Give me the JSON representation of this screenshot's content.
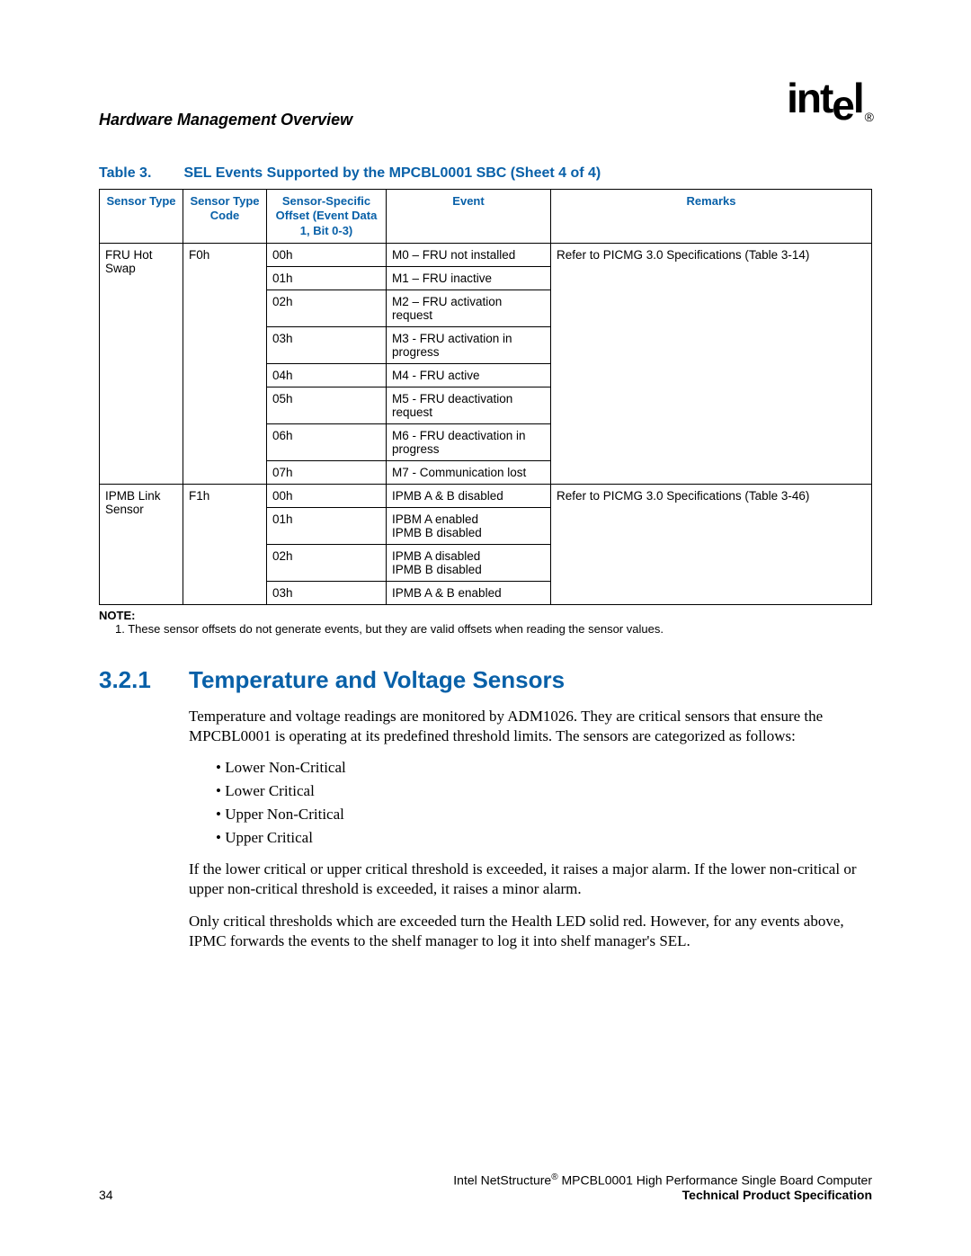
{
  "header": {
    "chapter_title": "Hardware Management Overview",
    "logo_text": "intel",
    "logo_reg": "®"
  },
  "table_caption": {
    "label": "Table 3.",
    "title": "SEL Events Supported by the MPCBL0001 SBC (Sheet 4 of 4)"
  },
  "table": {
    "headers": {
      "c0": "Sensor Type",
      "c1": "Sensor Type Code",
      "c2": "Sensor-Specific Offset (Event Data 1, Bit 0-3)",
      "c3": "Event",
      "c4": "Remarks"
    },
    "groups": [
      {
        "sensor_type": "FRU Hot Swap",
        "type_code": "F0h",
        "remarks": "Refer to PICMG 3.0 Specifications (Table 3-14)",
        "rows": [
          {
            "offset": "00h",
            "event": "M0 – FRU not installed"
          },
          {
            "offset": "01h",
            "event": "M1 – FRU inactive"
          },
          {
            "offset": "02h",
            "event": "M2 – FRU activation request"
          },
          {
            "offset": "03h",
            "event": "M3 - FRU activation in progress"
          },
          {
            "offset": "04h",
            "event": "M4 - FRU active"
          },
          {
            "offset": "05h",
            "event": "M5 - FRU deactivation request"
          },
          {
            "offset": "06h",
            "event": "M6 - FRU deactivation in progress"
          },
          {
            "offset": "07h",
            "event": "M7 - Communication lost"
          }
        ]
      },
      {
        "sensor_type": "IPMB Link Sensor",
        "type_code": "F1h",
        "remarks": "Refer to PICMG 3.0 Specifications (Table 3-46)",
        "rows": [
          {
            "offset": "00h",
            "event": "IPMB A & B disabled"
          },
          {
            "offset": "01h",
            "event": "IPBM A enabled\nIPMB B disabled"
          },
          {
            "offset": "02h",
            "event": "IPMB A disabled\nIPMB B disabled"
          },
          {
            "offset": "03h",
            "event": "IPMB A & B enabled"
          }
        ]
      }
    ]
  },
  "note": {
    "label": "NOTE:",
    "text": "1. These sensor offsets do not generate events, but they are valid offsets when reading the sensor values."
  },
  "section": {
    "number": "3.2.1",
    "title": "Temperature and Voltage Sensors"
  },
  "body": {
    "para1": "Temperature and voltage readings are monitored by ADM1026. They are critical sensors that ensure the MPCBL0001 is operating at its predefined threshold limits. The sensors are categorized as follows:",
    "bullets": [
      "Lower Non-Critical",
      "Lower Critical",
      "Upper Non-Critical",
      "Upper Critical"
    ],
    "para2": "If the lower critical or upper critical threshold is exceeded, it raises a major alarm. If the lower non-critical or upper non-critical threshold is exceeded, it raises a minor alarm.",
    "para3": "Only critical thresholds which are exceeded turn the Health LED solid red. However, for any events above, IPMC forwards the events to the shelf manager to log it into shelf manager's SEL."
  },
  "footer": {
    "page_number": "34",
    "product_line_prefix": "Intel NetStructure",
    "product_line_suffix": " MPCBL0001 High Performance Single Board Computer",
    "reg": "®",
    "doc_type": "Technical Product Specification"
  }
}
